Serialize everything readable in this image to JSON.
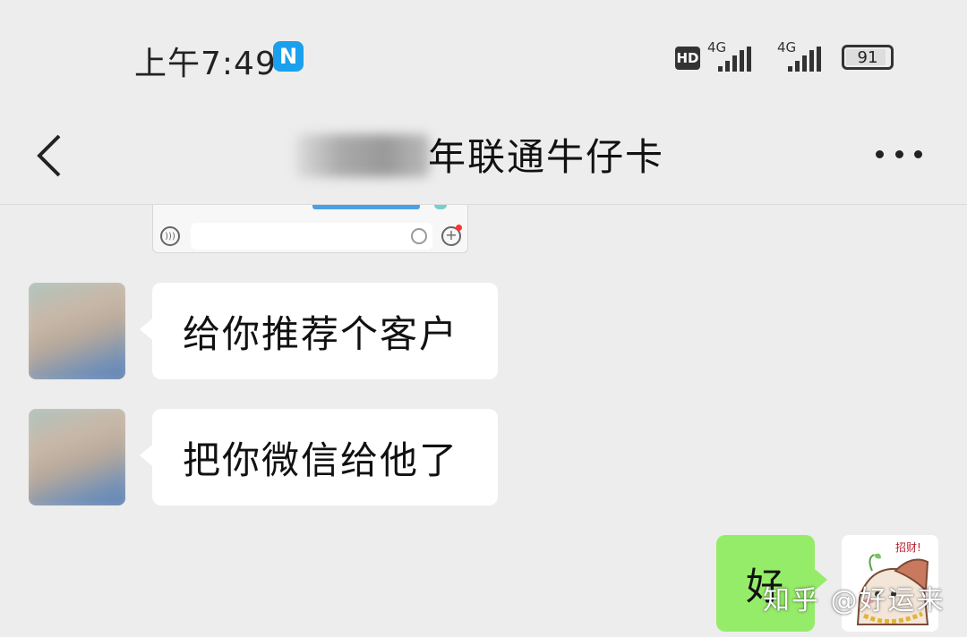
{
  "status_bar": {
    "time": "上午7:49",
    "app_badge": "N",
    "hd_label": "HD",
    "signal1_label": "4G",
    "signal2_label": "4G",
    "battery_level": "91"
  },
  "nav": {
    "title": "年联通牛仔卡"
  },
  "messages": [
    {
      "side": "left",
      "text": "给你推荐个客户"
    },
    {
      "side": "left",
      "text": "把你微信给他了"
    },
    {
      "side": "right",
      "text": "好"
    }
  ],
  "sticker": {
    "text": "招财!"
  },
  "watermark": "知乎 @好运来",
  "colors": {
    "background": "#ededed",
    "bubble_incoming": "#ffffff",
    "bubble_outgoing": "#95ec69",
    "app_badge": "#1aa0ec"
  }
}
